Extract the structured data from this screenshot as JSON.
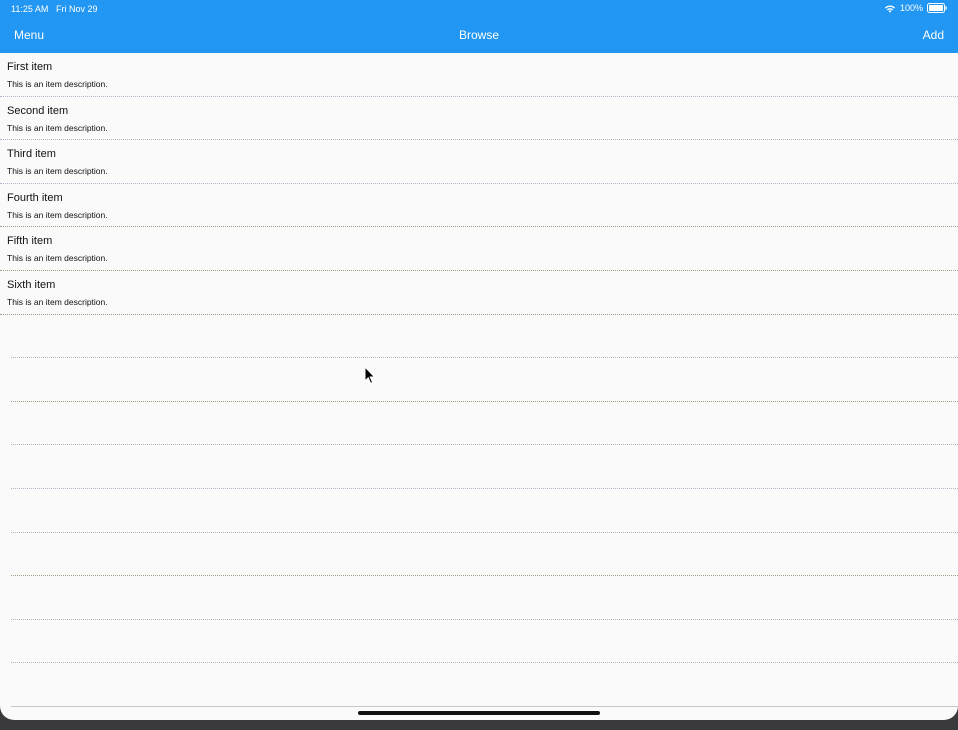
{
  "status_bar": {
    "time": "11:25 AM",
    "date": "Fri Nov 29",
    "battery": "100%",
    "wifi_icon": "wifi-icon",
    "battery_icon": "battery-icon"
  },
  "nav": {
    "left": "Menu",
    "title": "Browse",
    "right": "Add"
  },
  "items": [
    {
      "title": "First item",
      "description": "This is an item description."
    },
    {
      "title": "Second item",
      "description": "This is an item description."
    },
    {
      "title": "Third item",
      "description": "This is an item description."
    },
    {
      "title": "Fourth item",
      "description": "This is an item description."
    },
    {
      "title": "Fifth item",
      "description": "This is an item description."
    },
    {
      "title": "Sixth item",
      "description": "This is an item description."
    }
  ],
  "colors": {
    "header": "#2196f3",
    "background": "#fafafa",
    "text": "#111111"
  }
}
